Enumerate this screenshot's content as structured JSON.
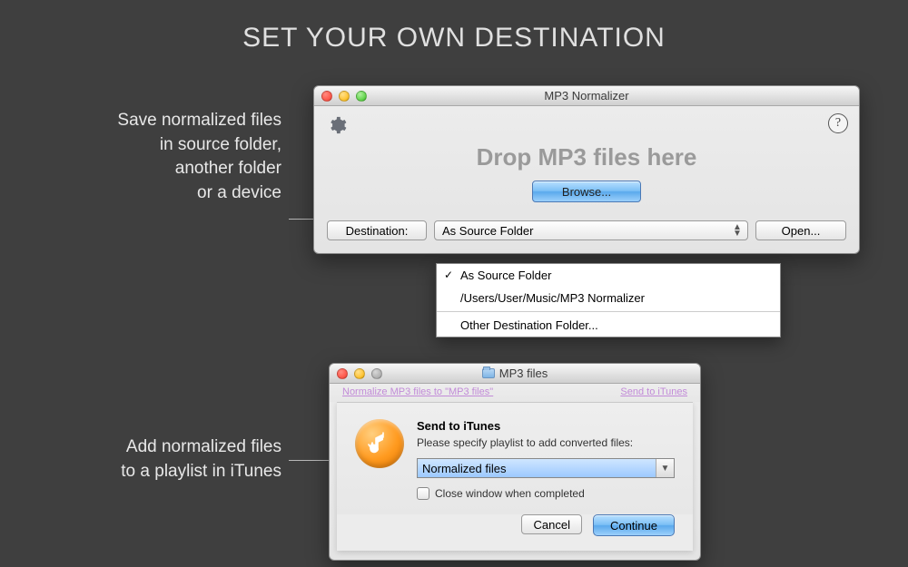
{
  "page_heading": "SET YOUR OWN DESTINATION",
  "caption1": {
    "l1": "Save normalized files",
    "l2": "in source folder,",
    "l3": "another folder",
    "l4": "or a device"
  },
  "caption2": {
    "l1": "Add normalized files",
    "l2": "to a playlist in iTunes"
  },
  "main_window": {
    "title": "MP3 Normalizer",
    "drop_text": "Drop MP3 files here",
    "browse": "Browse...",
    "destination_label": "Destination:",
    "selected_destination": "As Source Folder",
    "open": "Open..."
  },
  "dropdown": {
    "item1": "As Source Folder",
    "item2": "/Users/User/Music/MP3 Normalizer",
    "item3": "Other Destination Folder..."
  },
  "sheet_window": {
    "title": "MP3 files",
    "backdrop_left": "Normalize MP3 files to \"MP3 files\"",
    "backdrop_right": "Send to iTunes",
    "heading": "Send to iTunes",
    "subheading": "Please specify playlist to add converted files:",
    "playlist": "Normalized files",
    "checkbox": "Close window when completed",
    "cancel": "Cancel",
    "continue": "Continue"
  }
}
